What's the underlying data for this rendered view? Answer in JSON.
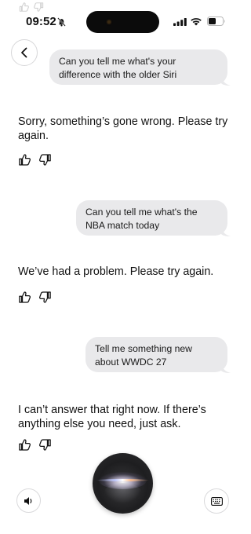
{
  "status_bar": {
    "time": "09:52"
  },
  "conversation": [
    {
      "user": "Can you tell me what's your difference with the older Siri",
      "reply": "Sorry, something’s gone wrong. Please try again."
    },
    {
      "user": "Can you tell me what's the NBA match today",
      "reply": "We’ve had a problem. Please try again."
    },
    {
      "user": "Tell me something new about WWDC 27",
      "reply": "I can’t answer that right now. If there’s anything else you need, just ask."
    }
  ],
  "icons": {
    "back": "chevron-left-icon",
    "thumbs_up": "thumbs-up-icon",
    "thumbs_down": "thumbs-down-icon",
    "speaker": "speaker-icon",
    "keyboard": "keyboard-icon",
    "siri": "siri-orb"
  },
  "colors": {
    "user_bubble": "#e9e9eb",
    "background": "#ffffff",
    "text": "#111111"
  }
}
